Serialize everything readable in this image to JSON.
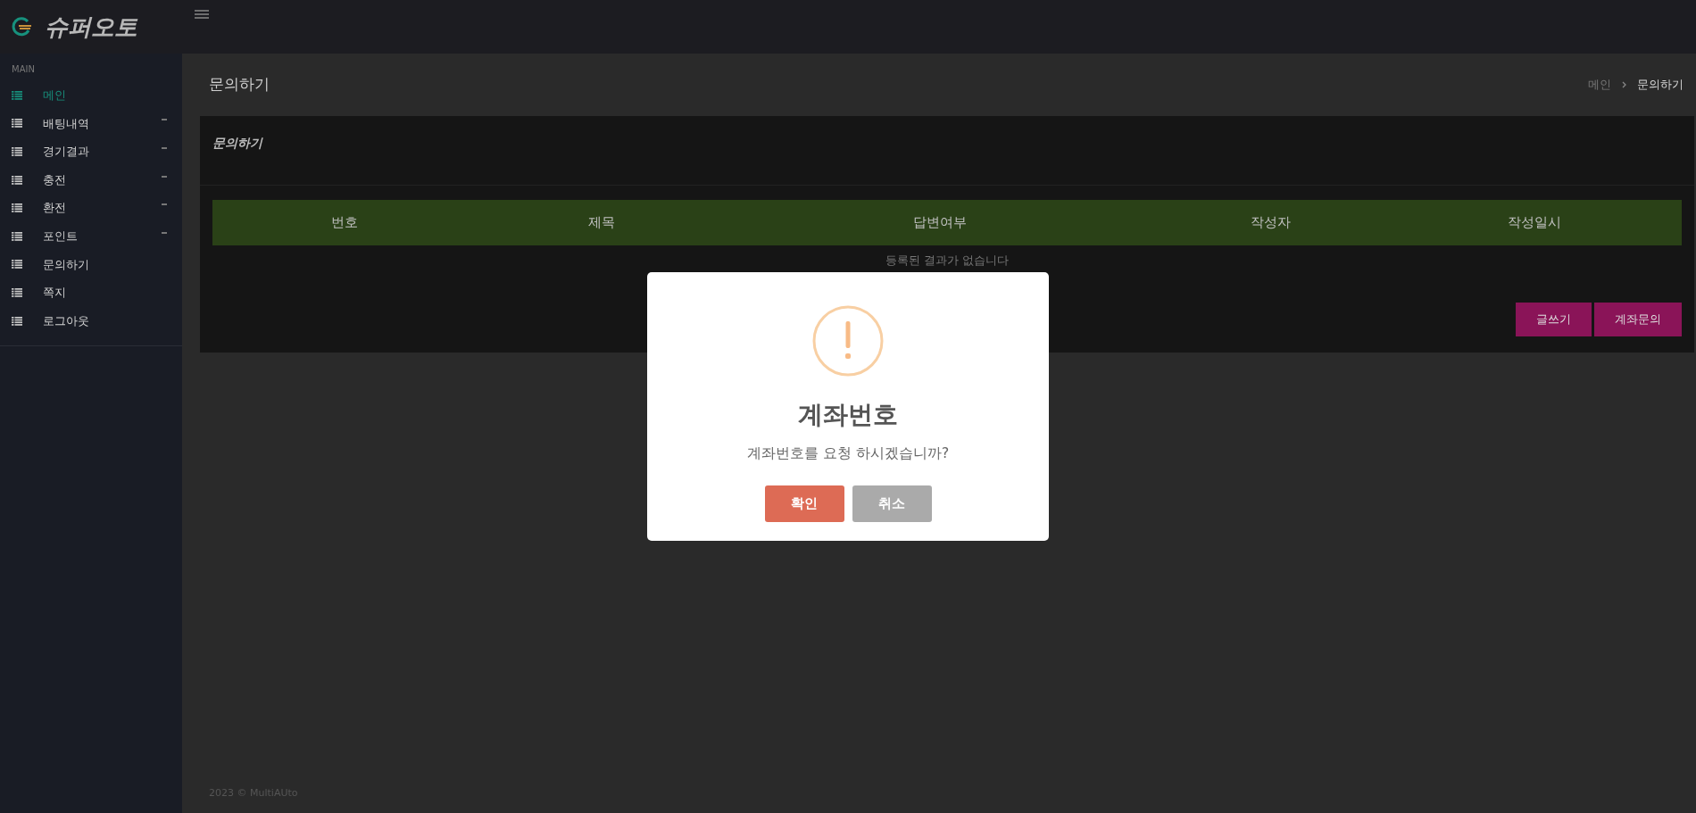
{
  "brand": {
    "name": "슈퍼오토"
  },
  "sidebar": {
    "section": "MAIN",
    "items": [
      {
        "label": "메인",
        "selected": true,
        "expandable": false
      },
      {
        "label": "배팅내역",
        "selected": false,
        "expandable": true
      },
      {
        "label": "경기결과",
        "selected": false,
        "expandable": true
      },
      {
        "label": "충전",
        "selected": false,
        "expandable": true
      },
      {
        "label": "환전",
        "selected": false,
        "expandable": true
      },
      {
        "label": "포인트",
        "selected": false,
        "expandable": true
      },
      {
        "label": "문의하기",
        "selected": false,
        "expandable": false
      },
      {
        "label": "쪽지",
        "selected": false,
        "expandable": false
      },
      {
        "label": "로그아웃",
        "selected": false,
        "expandable": false
      }
    ]
  },
  "page": {
    "title": "문의하기",
    "breadcrumb": [
      "메인",
      "문의하기"
    ]
  },
  "card": {
    "title": "문의하기",
    "table": {
      "columns": [
        "번호",
        "제목",
        "답변여부",
        "작성자",
        "작성일시"
      ],
      "empty_text": "등록된 결과가 없습니다"
    },
    "buttons": [
      "글쓰기",
      "계좌문의"
    ]
  },
  "dialog": {
    "title": "계좌번호",
    "message": "계좌번호를 요청 하시겠습니까?",
    "buttons": [
      {
        "label": "확인",
        "kind": "confirm"
      },
      {
        "label": "취소",
        "kind": "cancel"
      }
    ]
  },
  "footer": "2023 © MultiAUto"
}
